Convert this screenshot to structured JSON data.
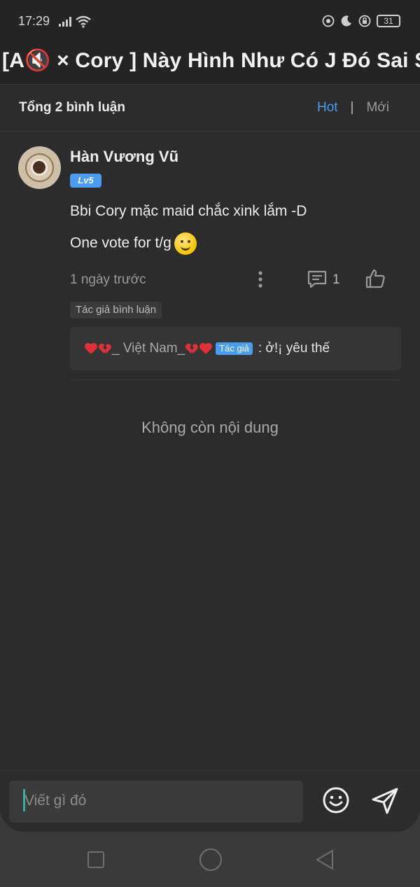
{
  "status_bar": {
    "time": "17:29",
    "battery": "31",
    "icons": [
      "signal-icon",
      "wifi-icon",
      "record-icon",
      "moon-icon",
      "lock-rotation-icon",
      "battery-icon"
    ]
  },
  "header": {
    "title": "[A🔇 × Cory ] Này Hình Như Có J Đó Sai Sai!!!?"
  },
  "summary": {
    "total_label": "Tổng 2 bình luận",
    "sort_hot": "Hot",
    "sort_separator": "|",
    "sort_new": "Mới",
    "active_sort": "Hot"
  },
  "comment": {
    "username": "Hàn Vương Vũ",
    "level": "Lv5",
    "lines": [
      "Bbi Cory mặc maid chắc xink lắm -D",
      "One vote for t/g"
    ],
    "time": "1 ngày trước",
    "reply_count": "1",
    "author_tag": "Tác giả bình luận",
    "reply": {
      "author": "_ Việt Nam_",
      "badge": "Tác giả",
      "text": ": ở!¡ yêu thế"
    }
  },
  "empty_state": "Không còn nội dung",
  "input": {
    "placeholder": "Viết gì đó"
  },
  "colors": {
    "accent": "#4a9cf0",
    "background": "#2c2c2c",
    "header_bg": "#242424",
    "cursor": "#2fb3a4"
  }
}
